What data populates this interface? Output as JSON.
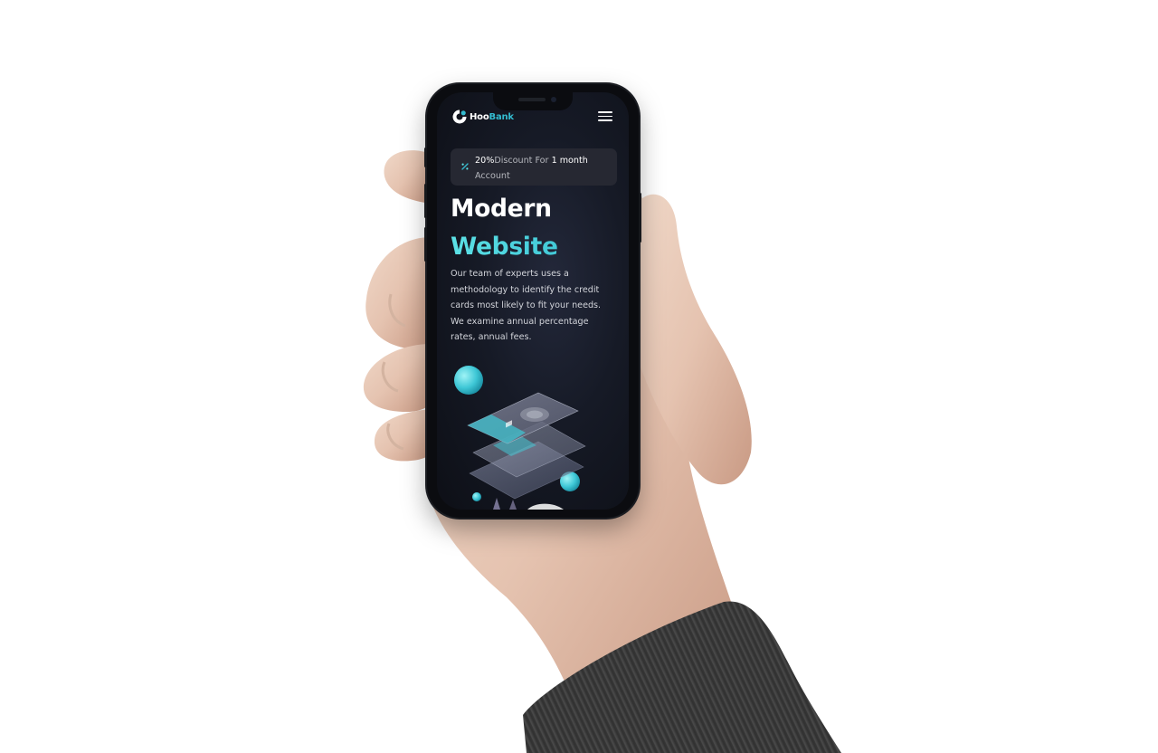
{
  "brand": {
    "name_prefix": "Hoo",
    "name_suffix": "Bank",
    "accent_color": "#33bbcf",
    "gradient_colors": [
      "#5ce1e6",
      "#33bbcf"
    ]
  },
  "nav": {
    "menu_icon": "hamburger-menu-icon"
  },
  "promo_badge": {
    "icon": "discount-icon",
    "percent": "20%",
    "text_middle": "Discount For",
    "text_highlight": "1 month",
    "text_end": "Account"
  },
  "hero": {
    "title_line1": "Modern",
    "title_line2": "Website",
    "description": "Our team of experts uses a methodology to identify the credit cards most likely to fit your needs. We examine annual percentage rates, annual fees."
  },
  "colors": {
    "screen_bg": "#161a26",
    "text_primary": "#ffffff",
    "text_secondary": "#d2d4da"
  }
}
